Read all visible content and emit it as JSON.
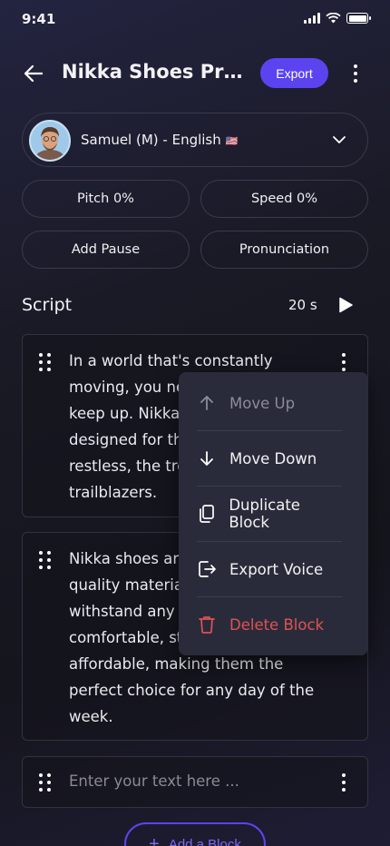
{
  "status": {
    "time": "9:41"
  },
  "header": {
    "title": "Nikka Shoes Pro...",
    "export_label": "Export"
  },
  "voice": {
    "name": "Samuel (M) - English",
    "flag": "🇺🇸"
  },
  "controls": {
    "pitch_label": "Pitch 0%",
    "speed_label": "Speed 0%",
    "pause_label": "Add Pause",
    "pronunciation_label": "Pronunciation"
  },
  "script": {
    "label": "Script",
    "duration": "20 s",
    "blocks": [
      {
        "text": "In a world that's constantly\nmoving, you ne\nkeep up. Nikka\ndesigned for th\nrestless, the tre\ntrailblazers."
      },
      {
        "text": "Nikka shoes are\nquality materia\nwithstand any \ncomfortable, st\naffordable, making them the\nperfect choice for any day of the\nweek."
      }
    ],
    "input_placeholder": "Enter your text here ..."
  },
  "menu": {
    "items": [
      {
        "label": "Move Up",
        "icon": "arrow-up-icon",
        "state": "disabled"
      },
      {
        "label": "Move Down",
        "icon": "arrow-down-icon",
        "state": "normal"
      },
      {
        "label": "Duplicate Block",
        "icon": "copy-icon",
        "state": "normal"
      },
      {
        "label": "Export Voice",
        "icon": "export-icon",
        "state": "normal"
      },
      {
        "label": "Delete Block",
        "icon": "trash-icon",
        "state": "danger"
      }
    ]
  },
  "add_block_label": "Add a Block",
  "colors": {
    "accent": "#5b44f0",
    "danger": "#e05252",
    "menu_bg": "#2a2b3a"
  }
}
